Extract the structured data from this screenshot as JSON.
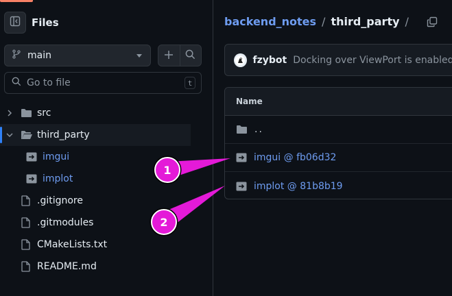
{
  "sidebar": {
    "title": "Files",
    "branch": "main",
    "search_placeholder": "Go to file",
    "search_shortcut": "t",
    "tree": [
      {
        "label": "src",
        "type": "folder",
        "expanded": false,
        "depth": 0
      },
      {
        "label": "third_party",
        "type": "folder",
        "expanded": true,
        "depth": 0,
        "selected": true
      },
      {
        "label": "imgui",
        "type": "submodule",
        "depth": 1
      },
      {
        "label": "implot",
        "type": "submodule",
        "depth": 1
      },
      {
        "label": ".gitignore",
        "type": "file",
        "depth": 0
      },
      {
        "label": ".gitmodules",
        "type": "file",
        "depth": 0
      },
      {
        "label": "CMakeLists.txt",
        "type": "file",
        "depth": 0
      },
      {
        "label": "README.md",
        "type": "file",
        "depth": 0
      }
    ]
  },
  "breadcrumb": {
    "repo": "backend_notes",
    "separator": "/",
    "current": "third_party",
    "trailing": "/"
  },
  "commit": {
    "author": "fzybot",
    "message": "Docking over ViewPort is enabled."
  },
  "table": {
    "header": "Name",
    "rows": [
      {
        "name": "..",
        "type": "parent"
      },
      {
        "name": "imgui @ fb06d32",
        "type": "submodule"
      },
      {
        "name": "implot @ 81b8b19",
        "type": "submodule"
      }
    ]
  },
  "annotations": [
    {
      "label": "1"
    },
    {
      "label": "2"
    }
  ],
  "colors": {
    "background": "#0d1117",
    "border": "#30363d",
    "link": "#6e9cf0",
    "accent": "#2f81f7",
    "annotation": "#e41ad8"
  }
}
